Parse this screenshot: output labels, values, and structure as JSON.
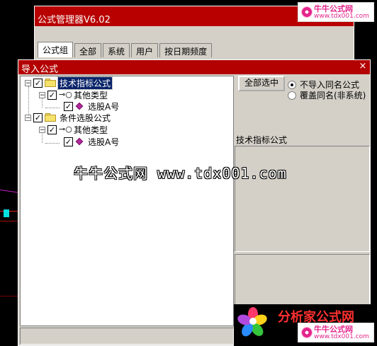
{
  "manager_window": {
    "title": "公式管理器V6.02",
    "tabs": [
      "公式组",
      "全部",
      "系统",
      "用户",
      "按日期频度"
    ]
  },
  "dialog": {
    "title": "导入公式",
    "close_label": "×",
    "tree": [
      {
        "label": "技术指标公式",
        "checked": true,
        "icon": "folder-icon",
        "selected": true
      },
      {
        "label": "其他类型",
        "checked": true,
        "icon": "key-icon"
      },
      {
        "label": "选股A号",
        "checked": true,
        "icon": "formula-diamond-icon"
      },
      {
        "label": "条件选股公式",
        "checked": true,
        "icon": "folder-icon"
      },
      {
        "label": "其他类型",
        "checked": true,
        "icon": "key-icon"
      },
      {
        "label": "选股A号",
        "checked": true,
        "icon": "formula-diamond-icon"
      }
    ],
    "select_all_label": "全部选中",
    "option_no_import": "不导入同名公式",
    "option_overwrite": "覆盖同名(非系统)",
    "selected_option": "不导入同名公式",
    "info_name": "技术指标公式"
  },
  "watermark": "牛牛公式网 www.tdx001.com",
  "logos": {
    "top_cn": "牛牛公式网",
    "top_url": "www.tdx001.com",
    "bottom_brand": "分析家公式网",
    "bottom_cn": "牛牛公式网",
    "bottom_url": "www.tdx001.com"
  },
  "colors": {
    "title_bar": "#b30000",
    "selection": "#0a246a",
    "dialog_bg": "#d4d0c8"
  }
}
